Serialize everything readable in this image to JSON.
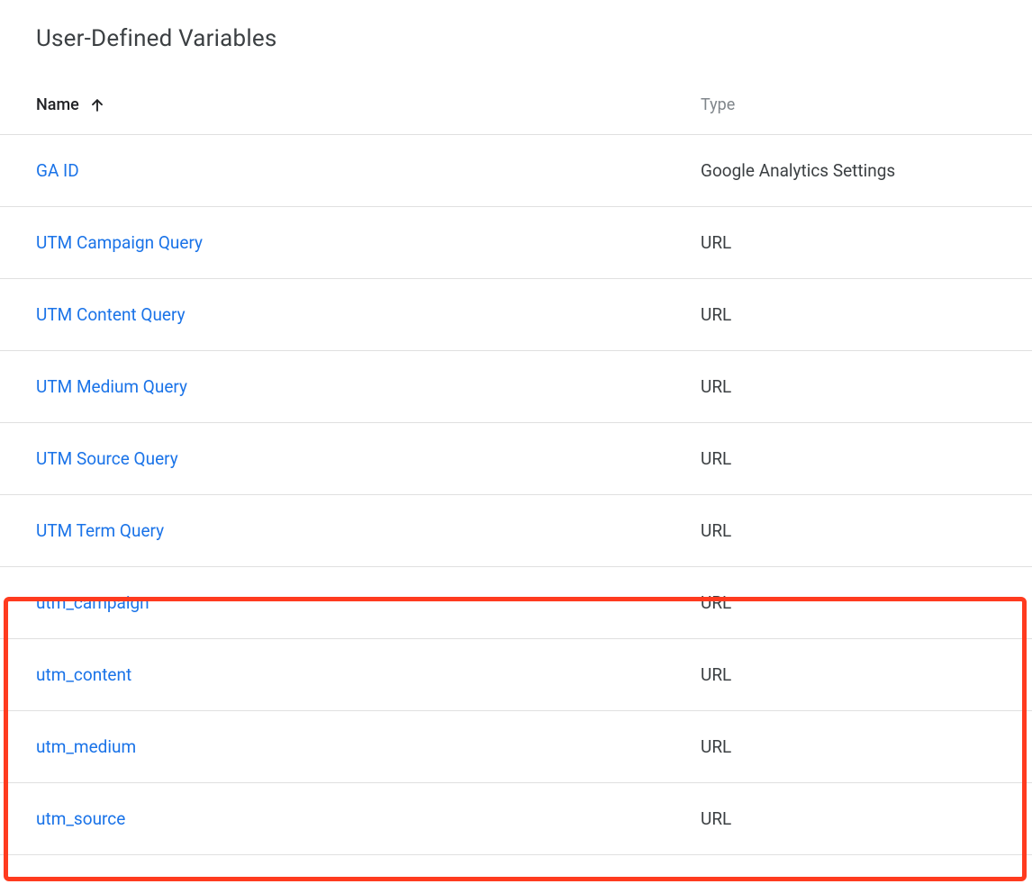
{
  "section": {
    "title": "User-Defined Variables"
  },
  "table": {
    "headers": {
      "name": "Name",
      "type": "Type"
    },
    "rows": [
      {
        "name": "GA ID",
        "type": "Google Analytics Settings"
      },
      {
        "name": "UTM Campaign Query",
        "type": "URL"
      },
      {
        "name": "UTM Content Query",
        "type": "URL"
      },
      {
        "name": "UTM Medium Query",
        "type": "URL"
      },
      {
        "name": "UTM Source Query",
        "type": "URL"
      },
      {
        "name": "UTM Term Query",
        "type": "URL"
      },
      {
        "name": "utm_campaign",
        "type": "URL"
      },
      {
        "name": "utm_content",
        "type": "URL"
      },
      {
        "name": "utm_medium",
        "type": "URL"
      },
      {
        "name": "utm_source",
        "type": "URL"
      }
    ]
  }
}
